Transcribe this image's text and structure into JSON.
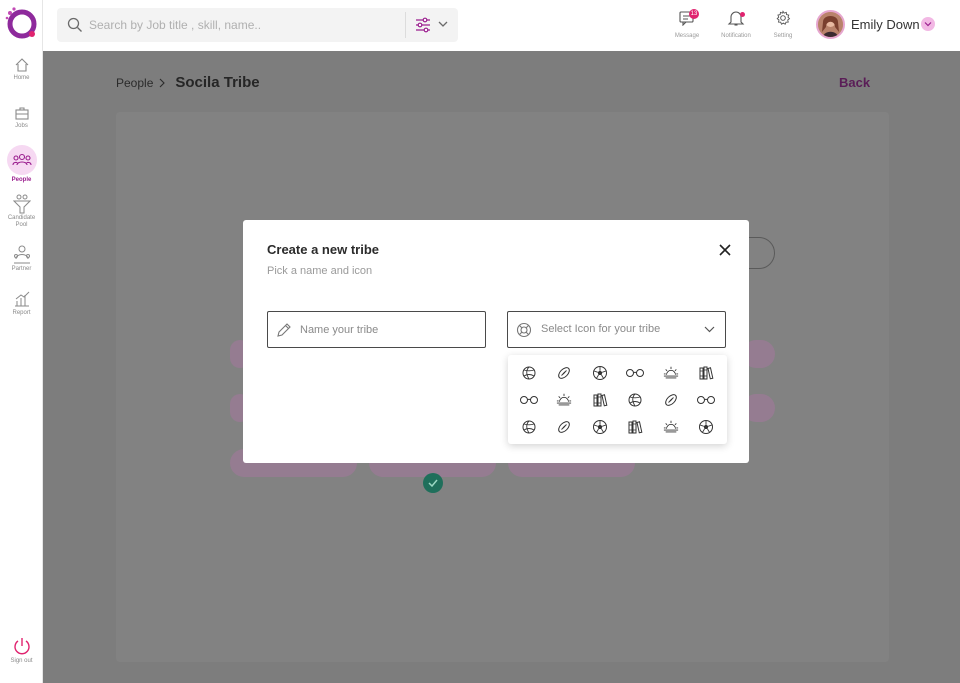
{
  "nav": {
    "home": "Home",
    "jobs": "Jobs",
    "people": "People",
    "candidate_pool": "Candidate Pool",
    "partner": "Partner",
    "report": "Report",
    "sign_out": "Sign out"
  },
  "header": {
    "search_placeholder": "Search by Job title , skill, name..",
    "message_label": "Message",
    "message_count": "13",
    "notification_label": "Notification",
    "setting_label": "Setting",
    "user_name": "Emily Down"
  },
  "page": {
    "breadcrumb_parent": "People",
    "breadcrumb_current": "Socila Tribe",
    "back_label": "Back"
  },
  "modal": {
    "title": "Create a new tribe",
    "subtitle": "Pick a name and icon",
    "name_placeholder": "Name your tribe",
    "icon_select_label": "Select Icon for your tribe"
  },
  "icon_grid": [
    [
      "volleyball-icon",
      "football-icon",
      "soccer-ball-icon",
      "glasses-icon",
      "sunrise-icon",
      "books-icon"
    ],
    [
      "glasses-icon",
      "sunrise-icon",
      "books-icon",
      "volleyball-icon",
      "football-icon",
      "glasses-icon"
    ],
    [
      "volleyball-icon",
      "football-icon",
      "soccer-ball-icon",
      "books-icon",
      "sunrise-icon",
      "soccer-ball-icon"
    ]
  ],
  "colors": {
    "brand": "#9b1f8f",
    "accent_pink": "#e0236f",
    "overlay": "#7d7d7d"
  }
}
